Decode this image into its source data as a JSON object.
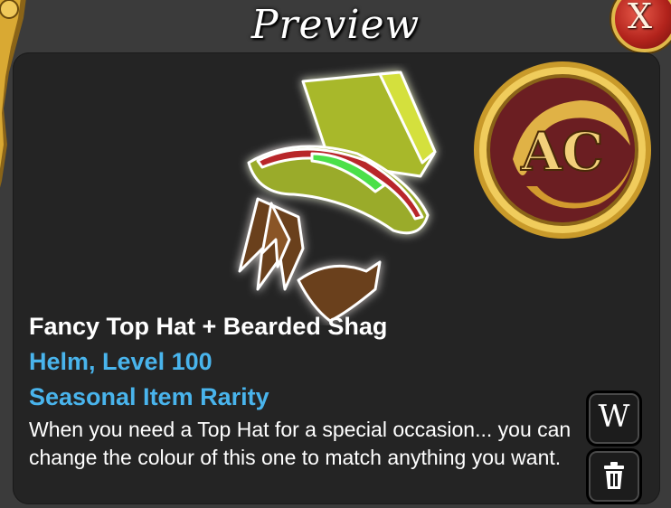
{
  "window": {
    "title": "Preview",
    "close_label": "X"
  },
  "item": {
    "name": "Fancy Top Hat + Bearded Shag",
    "type": "Helm, Level 100",
    "rarity": "Seasonal Item Rarity",
    "description": "When you need a Top Hat for a special occasion... you can change the colour of this one to match anything you want."
  },
  "currency_badge": {
    "label": "AC"
  },
  "actions": {
    "wear_label": "W",
    "trash_icon": "trash-icon"
  },
  "colors": {
    "accent_blue": "#49b4ec",
    "panel_bg": "#242424",
    "hat_green": "#a8b82c",
    "gold": "#d8a534",
    "coin_red": "#6b1e22"
  }
}
